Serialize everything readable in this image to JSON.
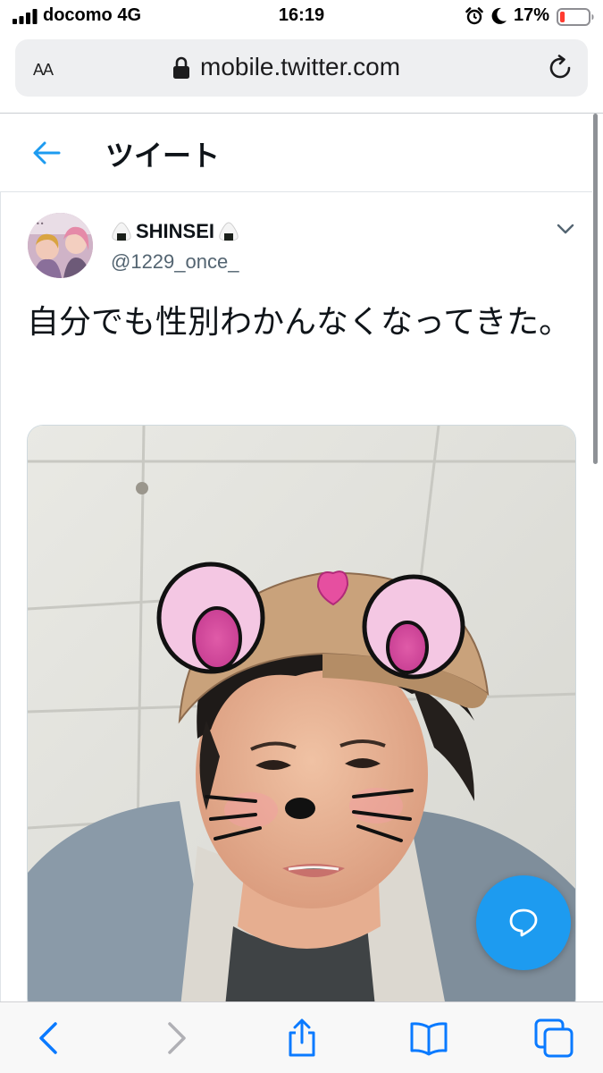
{
  "status_bar": {
    "carrier": "docomo 4G",
    "time": "16:19",
    "battery_percent": "17%",
    "battery_level": 0.17,
    "icons": [
      "signal-icon",
      "alarm-icon",
      "moon-icon",
      "battery-icon"
    ]
  },
  "address_bar": {
    "text_size_label": "AA",
    "url": "mobile.twitter.com",
    "icons": [
      "lock-icon",
      "reload-icon"
    ]
  },
  "header": {
    "title": "ツイート",
    "icons": [
      "back-arrow-icon"
    ]
  },
  "tweet": {
    "display_name": "SHINSEI",
    "handle": "@1229_once_",
    "text": "自分でも性別わかんなくなってきた。",
    "icons": [
      "onigiri-emoji-icon",
      "caret-down-icon"
    ]
  },
  "compose": {
    "icons": [
      "compose-tweet-icon"
    ]
  },
  "toolbar": {
    "icons": [
      "back-icon",
      "forward-icon",
      "share-icon",
      "bookmarks-icon",
      "tabs-icon"
    ]
  },
  "colors": {
    "twitter_blue": "#1d9bf0",
    "safari_blue": "#0a7aff",
    "text_primary": "#0f1419",
    "text_secondary": "#536471"
  }
}
